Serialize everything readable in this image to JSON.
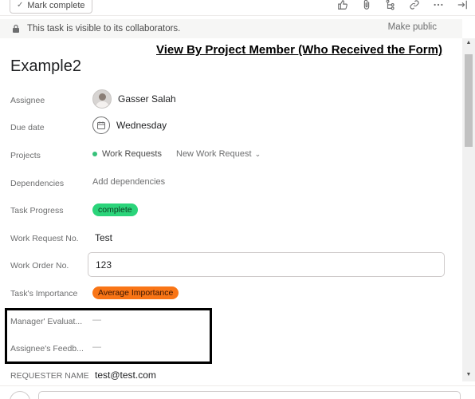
{
  "toolbar": {
    "mark_complete_label": "Mark complete",
    "icons": [
      "thumbs-up-icon",
      "attachment-icon",
      "subtask-icon",
      "link-icon",
      "more-icon",
      "close-panel-icon"
    ]
  },
  "visibility": {
    "message": "This task is visible to its collaborators.",
    "make_public": "Make public"
  },
  "task": {
    "title": "Example2"
  },
  "annotation": {
    "text": "View By Project Member (Who Received the Form)"
  },
  "fields": {
    "assignee": {
      "label": "Assignee",
      "value": "Gasser Salah"
    },
    "due_date": {
      "label": "Due date",
      "value": "Wednesday"
    },
    "projects": {
      "label": "Projects",
      "project": "Work Requests",
      "section": "New Work Request",
      "project_color": "#37c17a"
    },
    "dependencies": {
      "label": "Dependencies",
      "value": "Add dependencies"
    },
    "task_progress": {
      "label": "Task Progress",
      "value": "complete",
      "color": "#2bd47a"
    },
    "work_request_no": {
      "label": "Work Request No.",
      "value": "Test"
    },
    "work_order_no": {
      "label": "Work Order No.",
      "value": "123"
    },
    "task_importance": {
      "label": "Task's Importance",
      "value": "Average Importance",
      "color": "#f97516"
    },
    "manager_evaluation": {
      "label": "Manager' Evaluat...",
      "value": "—"
    },
    "assignee_feedback": {
      "label": "Assignee's Feedb...",
      "value": "—"
    },
    "requester_name": {
      "label": "REQUESTER NAME",
      "value": "test@test.com"
    }
  }
}
